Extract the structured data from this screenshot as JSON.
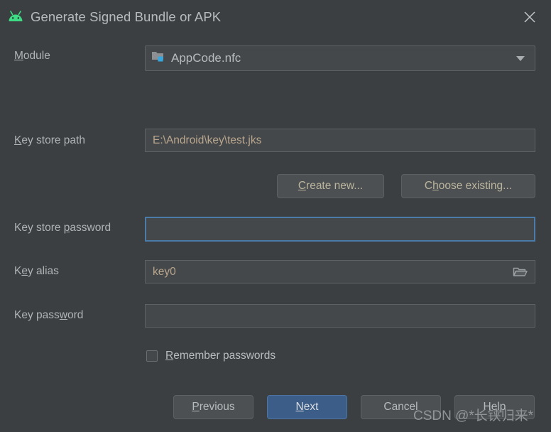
{
  "window": {
    "title": "Generate Signed Bundle or APK",
    "app_icon": "android-robot-icon",
    "close_icon": "close-icon"
  },
  "form": {
    "module": {
      "label": "Module",
      "label_pre": "M",
      "label_post": "odule",
      "value": "AppCode.nfc",
      "icon": "module-folder-icon",
      "caret_icon": "chevron-down-icon"
    },
    "key_store_path": {
      "label_pre": "K",
      "label_post": "ey store path",
      "value": "E:\\Android\\key\\test.jks",
      "placeholder": ""
    },
    "create_new_button": {
      "pre": "C",
      "key": "",
      "post": "reate new..."
    },
    "choose_existing_button": {
      "pre": "C",
      "key": "h",
      "post": "oose existing..."
    },
    "key_store_password": {
      "label_pre": "Key store ",
      "label_key": "p",
      "label_post": "assword",
      "value": "",
      "focused": true
    },
    "key_alias": {
      "label_pre": "K",
      "label_key": "e",
      "label_post": "y alias",
      "value": "key0",
      "browse_icon": "folder-open-icon"
    },
    "key_password": {
      "label_pre": "Key pass",
      "label_key": "w",
      "label_post": "ord",
      "value": ""
    },
    "remember_passwords": {
      "label_pre": "",
      "label_key": "R",
      "label_post": "emember passwords",
      "checked": false
    }
  },
  "footer": {
    "previous": {
      "pre": "",
      "key": "P",
      "post": "revious"
    },
    "next": {
      "pre": "",
      "key": "N",
      "post": "ext"
    },
    "cancel": {
      "pre": "",
      "key": "",
      "post": "Cancel"
    },
    "help": {
      "pre": "",
      "key": "",
      "post": "Help"
    }
  },
  "watermark": {
    "text": "CSDN @*长铗归来*"
  },
  "colors": {
    "background": "#3c3f41",
    "field_background": "#45484a",
    "accent_blue": "#3c5d87",
    "focus_border": "#4b7ba8",
    "android_green": "#3ddc84",
    "module_blue": "#35a8e0",
    "text": "#b7bbbd",
    "value_text": "#b9a68e"
  }
}
